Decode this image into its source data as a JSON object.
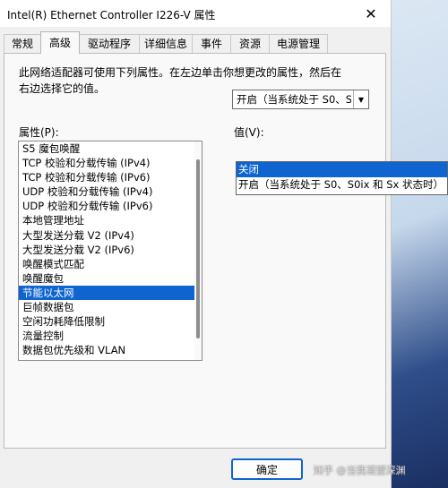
{
  "window": {
    "title": "Intel(R) Ethernet Controller I226-V 属性"
  },
  "tabs": [
    {
      "label": "常规"
    },
    {
      "label": "高级"
    },
    {
      "label": "驱动程序"
    },
    {
      "label": "详细信息"
    },
    {
      "label": "事件"
    },
    {
      "label": "资源"
    },
    {
      "label": "电源管理"
    }
  ],
  "description": "此网络适配器可使用下列属性。在左边单击你想更改的属性，然后在右边选择它的值。",
  "property_label": "属性(P):",
  "value_label": "值(V):",
  "properties": [
    "S5 魔包唤醒",
    "TCP 校验和分载传输 (IPv4)",
    "TCP 校验和分载传输 (IPv6)",
    "UDP 校验和分载传输 (IPv4)",
    "UDP 校验和分载传输 (IPv6)",
    "本地管理地址",
    "大型发送分载 V2 (IPv4)",
    "大型发送分载 V2 (IPv6)",
    "唤醒模式匹配",
    "唤醒魔包",
    "节能以太网",
    "巨帧数据包",
    "空闲功耗降低限制",
    "流量控制",
    "数据包优先级和 VLAN"
  ],
  "selected_property": "节能以太网",
  "value_combo": {
    "current": "开启（当系统处于 S0、S0"
  },
  "value_options": [
    "关闭",
    "开启（当系统处于 S0、S0ix 和 Sx 状态时）"
  ],
  "buttons": {
    "ok": "确定"
  },
  "watermark": "知乎 @当我凝望深渊",
  "colors": {
    "selection": "#0f64d0",
    "dialog_bg": "#f0f0f0"
  }
}
